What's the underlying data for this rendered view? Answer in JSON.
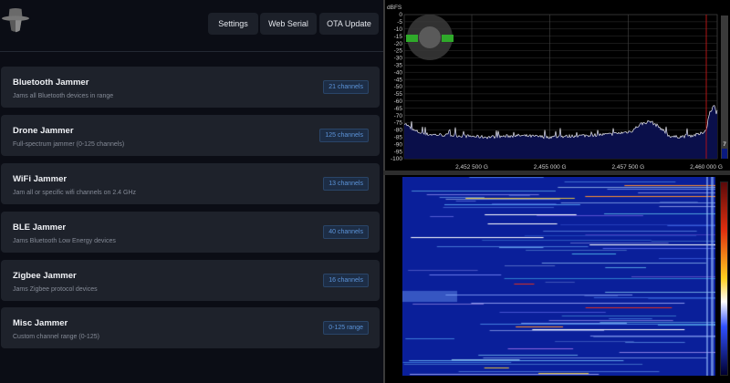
{
  "header": {
    "buttons": [
      "Settings",
      "Web Serial",
      "OTA Update"
    ]
  },
  "jammers": [
    {
      "title": "Bluetooth Jammer",
      "desc": "Jams all Bluetooth devices in range",
      "badge": "21 channels"
    },
    {
      "title": "Drone Jammer",
      "desc": "Full-spectrum jammer (0-125 channels)",
      "badge": "125 channels"
    },
    {
      "title": "WiFi Jammer",
      "desc": "Jam all or specific wifi channels on 2.4 GHz",
      "badge": "13 channels"
    },
    {
      "title": "BLE Jammer",
      "desc": "Jams Bluetooth Low Energy devices",
      "badge": "40 channels"
    },
    {
      "title": "Zigbee Jammer",
      "desc": "Jams Zigbee protocol devices",
      "badge": "16 channels"
    },
    {
      "title": "Misc Jammer",
      "desc": "Custom channel range (0-125)",
      "badge": "0-125 range"
    }
  ],
  "spectrum": {
    "unit_label": "dBFS",
    "side_value": "7",
    "colors": {
      "trace": "#e8e8f0",
      "fill": "#0a0f4a",
      "marker": "#d01010",
      "dial": "#2faa2a"
    },
    "chart_data": {
      "type": "area",
      "ylabel": "dBFS",
      "ylim": [
        -100,
        0
      ],
      "yticks": [
        0,
        -5,
        -10,
        -15,
        -20,
        -25,
        -30,
        -35,
        -40,
        -45,
        -50,
        -55,
        -60,
        -65,
        -70,
        -75,
        -80,
        -85,
        -90,
        -95,
        -100
      ],
      "xlim_mhz": [
        2450.34,
        2460.35
      ],
      "xticks": [
        {
          "v": 2452.5,
          "label": "2,452 500 G"
        },
        {
          "v": 2455.0,
          "label": "2,455 000 G"
        },
        {
          "v": 2457.5,
          "label": "2,457 500 G"
        },
        {
          "v": 2460.0,
          "label": "2,460 000 G"
        }
      ],
      "marker_mhz": 2460.0,
      "x": [
        2450.34,
        2450.6,
        2451.0,
        2452.0,
        2453.0,
        2454.0,
        2455.0,
        2456.0,
        2457.0,
        2457.6,
        2457.9,
        2458.2,
        2458.5,
        2458.8,
        2459.0,
        2459.5,
        2459.8,
        2460.0,
        2460.1,
        2460.25,
        2460.35
      ],
      "y": [
        -75,
        -80,
        -83,
        -84,
        -85,
        -84,
        -85,
        -84,
        -83,
        -81,
        -76,
        -74,
        -78,
        -84,
        -85,
        -84,
        -83,
        -80,
        -68,
        -63,
        -70
      ]
    }
  }
}
